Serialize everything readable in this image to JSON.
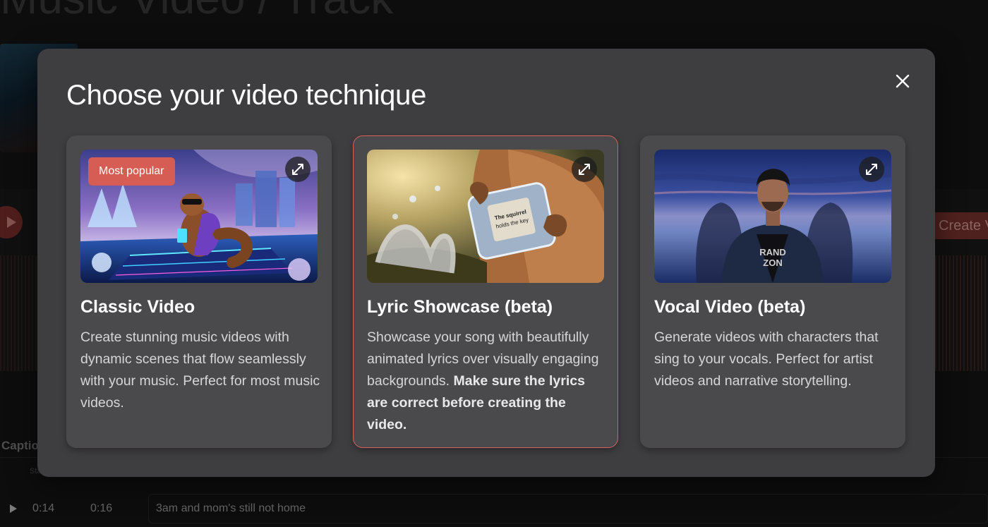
{
  "background": {
    "page_title": "Music Video / Track",
    "create_button_label": "Create Video",
    "captions_label": "Captions",
    "caption_columns": {
      "start": "Start"
    },
    "caption_row": {
      "start": "0:14",
      "end": "0:16",
      "text": "3am and mom's still not home"
    }
  },
  "modal": {
    "title": "Choose your video technique",
    "close_icon": "close-icon",
    "cards": [
      {
        "title": "Classic Video",
        "badge": "Most popular",
        "description": "Create stunning music videos with dynamic scenes that flow seamlessly with your music. Perfect for most music videos.",
        "selected": false
      },
      {
        "title": "Lyric Showcase (beta)",
        "description": "Showcase your song with beautifully animated lyrics over visually engaging backgrounds.",
        "description_bold": "Make sure the lyrics are correct before creating the video.",
        "chip_text_1": "The squirrel",
        "chip_text_2": "holds the key",
        "selected": true
      },
      {
        "title": "Vocal Video (beta)",
        "description": "Generate videos with characters that sing to your vocals. Perfect for artist videos and narrative storytelling.",
        "shirt_text_1": "RAND",
        "shirt_text_2": "ZON",
        "selected": false
      }
    ]
  },
  "colors": {
    "modal_bg": "#3e3d3f",
    "card_bg": "#4a494c",
    "accent": "#d55d53",
    "selected_border": "#d8625b"
  }
}
